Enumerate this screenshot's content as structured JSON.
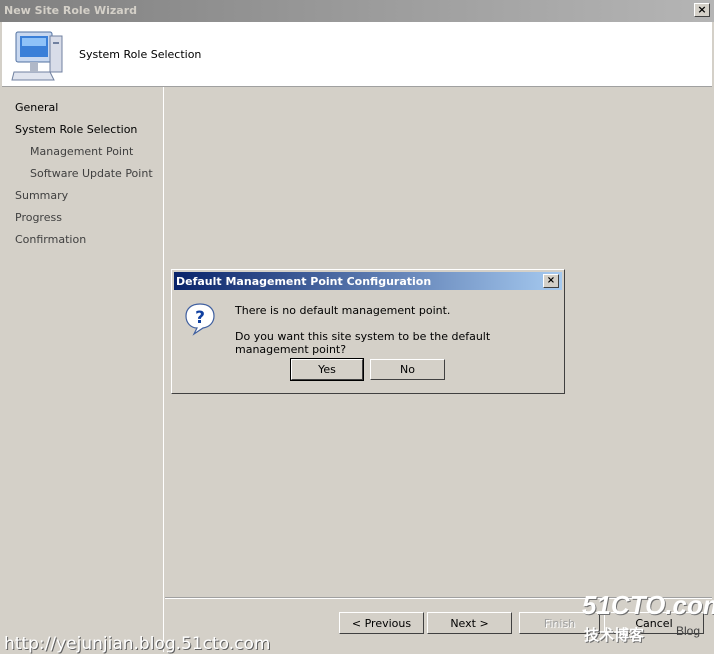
{
  "window": {
    "title": "New Site Role Wizard",
    "close_glyph": "×"
  },
  "header": {
    "title": "System Role Selection",
    "icon": "computer-icon"
  },
  "nav": {
    "items": [
      {
        "label": "General"
      },
      {
        "label": "System Role Selection"
      },
      {
        "label": "Management Point"
      },
      {
        "label": "Software Update Point"
      },
      {
        "label": "Summary"
      },
      {
        "label": "Progress"
      },
      {
        "label": "Confirmation"
      }
    ]
  },
  "buttons": {
    "previous": "< Previous",
    "next": "Next >",
    "finish": "Finish",
    "cancel": "Cancel"
  },
  "dialog": {
    "title": "Default Management Point Configuration",
    "close_glyph": "×",
    "icon": "question-icon",
    "message1": "There is no default management point.",
    "message2": "Do you want this site system to be the default management point?",
    "yes": "Yes",
    "no": "No"
  },
  "watermark": {
    "url": "http://yejunjian.blog.51cto.com",
    "logo": "51CTO.com",
    "sub": "技术博客",
    "blog": "Blog"
  },
  "colors": {
    "face": "#d4d0c8",
    "dialog_title_start": "#0a246a",
    "dialog_title_end": "#a6caf0",
    "inactive_title": "#808080"
  }
}
